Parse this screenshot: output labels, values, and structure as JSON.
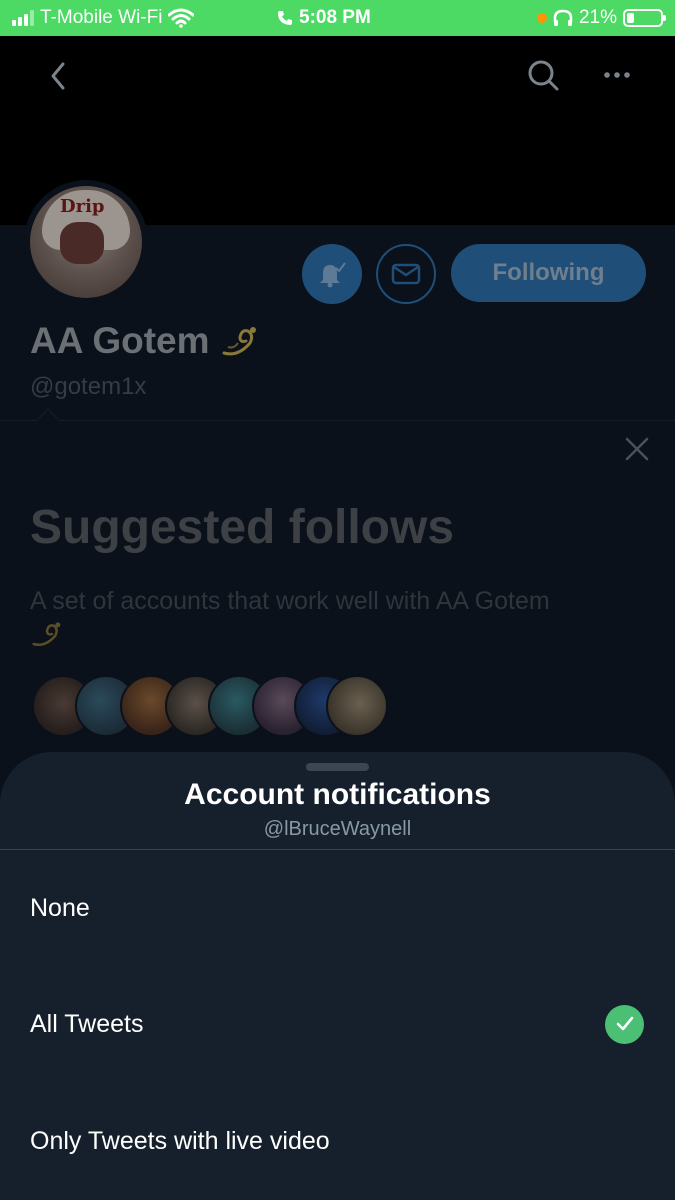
{
  "status_bar": {
    "carrier": "T-Mobile Wi-Fi",
    "time": "5:08 PM",
    "battery_percent": "21%",
    "battery_level": 0.21,
    "background_color": "#4cd964"
  },
  "profile": {
    "name": "AA Gotem",
    "handle": "@gotem1x",
    "following_label": "Following",
    "avatar_text": "Drip"
  },
  "suggested": {
    "title": "Suggested follows",
    "description": "A set of accounts that work well with AA Gotem"
  },
  "sheet": {
    "title": "Account notifications",
    "subtitle": "@lBruceWaynell",
    "options": [
      {
        "label": "None",
        "selected": false
      },
      {
        "label": "All Tweets",
        "selected": true
      },
      {
        "label": "Only Tweets with live video",
        "selected": false
      }
    ]
  },
  "colors": {
    "sheet_background": "#16202c",
    "check_green": "#4bbf73",
    "accent_blue": "#1f4f78"
  },
  "icons": [
    "back-icon",
    "search-icon",
    "more-icon",
    "bell-icon",
    "mail-icon",
    "close-icon",
    "sparkle-icon",
    "check-icon"
  ]
}
